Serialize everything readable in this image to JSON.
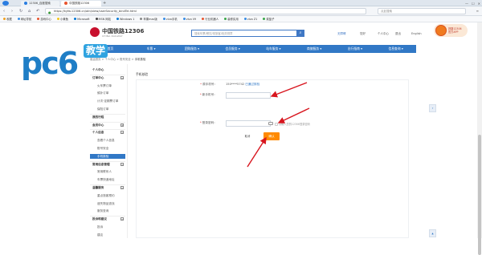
{
  "browser": {
    "tabs": [
      {
        "label": "12306_百度搜索"
      },
      {
        "label": "中国铁路12306"
      }
    ],
    "new_tab_icon": "plus-icon",
    "url": "https://kyfw.12306.cn/otn/view/userSecurity_bindTel.html",
    "search_placeholder": "点此搜索",
    "window_controls": [
      "—",
      "☐",
      "✕"
    ],
    "nav_icons": [
      "back-icon",
      "forward-icon",
      "refresh-icon",
      "home-icon"
    ],
    "bookmarks": [
      {
        "label": "收藏",
        "color": "#f0a020"
      },
      {
        "label": "网址导航",
        "color": "#3a8ee6"
      },
      {
        "label": "游戏中心",
        "color": "#e8542f"
      },
      {
        "label": "小黄鱼",
        "color": "#f5c518"
      },
      {
        "label": "Microsoft",
        "color": "#0078d7"
      },
      {
        "label": "MSN 网站",
        "color": "#444"
      },
      {
        "label": "Windows 1",
        "color": "#0078d7"
      },
      {
        "label": "苹果mac版",
        "color": "#888"
      },
      {
        "label": "vivo手机",
        "color": "#3a8ee6"
      },
      {
        "label": "vivo V9",
        "color": "#3a8ee6"
      },
      {
        "label": "行业机器人",
        "color": "#e8542f"
      },
      {
        "label": "装修实用",
        "color": "#3aa84a"
      },
      {
        "label": "vivo Z1",
        "color": "#3a8ee6"
      },
      {
        "label": "菜篮子",
        "color": "#3aa84a"
      }
    ]
  },
  "site": {
    "logo_cn": "中国铁路12306",
    "logo_en": "CHINA RAILWAY",
    "search_placeholder": "搜索车票/餐饮/常旅客/相关规章",
    "header_links": [
      "无障碍",
      "个人中心",
      "退出",
      "English"
    ],
    "user_greeting": "您好",
    "promo_text": "铁路12306",
    "promo_sub": "官方APP",
    "nav": [
      "首页",
      "车票 ▾",
      "团购服务 ▾",
      "会员服务 ▾",
      "站车服务 ▾",
      "商旅服务 ▾",
      "出行指南 ▾",
      "信息查询 ▾"
    ],
    "breadcrumb": "客运首页 > 个人中心 > 账号安全 > ",
    "breadcrumb_current": "手机核验"
  },
  "watermark": {
    "brand": "pc6",
    "tag": "教学"
  },
  "sidebar": {
    "items": [
      {
        "label": "个人中心",
        "type": "head"
      },
      {
        "label": "订单中心",
        "type": "head",
        "expand": "−"
      },
      {
        "label": "火车票订单",
        "type": "sub"
      },
      {
        "label": "候补订单",
        "type": "sub"
      },
      {
        "label": "计次·定期票订单",
        "type": "sub"
      },
      {
        "label": "保险订单",
        "type": "sub"
      },
      {
        "label": "我的行程",
        "type": "head"
      },
      {
        "label": "会员中心",
        "type": "head",
        "expand": "+"
      },
      {
        "label": "个人信息",
        "type": "head",
        "expand": "−"
      },
      {
        "label": "查看个人信息",
        "type": "sub"
      },
      {
        "label": "账号安全",
        "type": "sub"
      },
      {
        "label": "手机核验",
        "type": "sub",
        "active": true
      },
      {
        "label": "常用信息管理",
        "type": "head",
        "expand": "−"
      },
      {
        "label": "常用联系人",
        "type": "sub"
      },
      {
        "label": "车票快递地址",
        "type": "sub"
      },
      {
        "label": "温馨服务",
        "type": "head",
        "expand": "−"
      },
      {
        "label": "重点旅客预约",
        "type": "sub"
      },
      {
        "label": "遗失物品查找",
        "type": "sub"
      },
      {
        "label": "服务查询",
        "type": "sub"
      },
      {
        "label": "投诉和建议",
        "type": "head",
        "expand": "−"
      },
      {
        "label": "投诉",
        "type": "sub"
      },
      {
        "label": "建议",
        "type": "sub"
      }
    ]
  },
  "content": {
    "title": "手机核验",
    "original_phone_label": "原手机号：",
    "original_phone_value": "150****5742",
    "verified_text": "已通过核验",
    "new_phone_label": "新手机号：",
    "new_phone_value": "",
    "login_pwd_label": "登录密码：",
    "login_pwd_value": "",
    "hint_text": "请输入您的12306登录密码",
    "cancel_label": "取消",
    "confirm_label": "确认"
  },
  "colors": {
    "primary": "#3178c6",
    "confirm": "#ff8a00",
    "arrow": "#d8161f",
    "logo_red": "#c8102e"
  }
}
